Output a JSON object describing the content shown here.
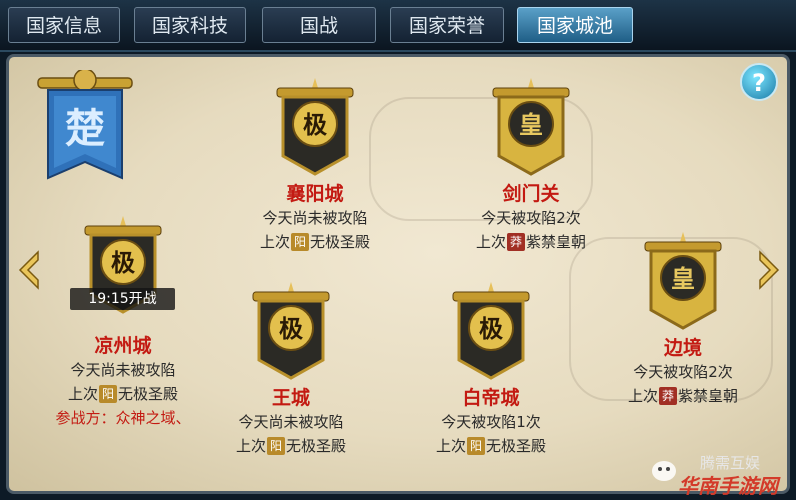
{
  "tabs": [
    {
      "label": "国家信息",
      "active": false
    },
    {
      "label": "国家科技",
      "active": false
    },
    {
      "label": "国战",
      "active": false
    },
    {
      "label": "国家荣誉",
      "active": false
    },
    {
      "label": "国家城池",
      "active": true
    }
  ],
  "help_label": "?",
  "faction": {
    "glyph": "楚"
  },
  "cities": [
    {
      "name": "襄阳城",
      "level_glyph": "极",
      "status": "今天尚未被攻陷",
      "last_prefix": "上次",
      "last_badge": "阳",
      "last_owner": "无极圣殿"
    },
    {
      "name": "剑门关",
      "level_glyph": "皇",
      "status": "今天被攻陷2次",
      "last_prefix": "上次",
      "last_badge": "莽",
      "last_owner": "紫禁皇朝"
    },
    {
      "name": "凉州城",
      "level_glyph": "极",
      "status": "今天尚未被攻陷",
      "last_prefix": "上次",
      "last_badge": "阳",
      "last_owner": "无极圣殿",
      "timer": "19:15开战",
      "participants": "参战方：众神之域、"
    },
    {
      "name": "王城",
      "level_glyph": "极",
      "status": "今天尚未被攻陷",
      "last_prefix": "上次",
      "last_badge": "阳",
      "last_owner": "无极圣殿"
    },
    {
      "name": "白帝城",
      "level_glyph": "极",
      "status": "今天被攻陷1次",
      "last_prefix": "上次",
      "last_badge": "阳",
      "last_owner": "无极圣殿"
    },
    {
      "name": "边境",
      "level_glyph": "皇",
      "status": "今天被攻陷2次",
      "last_prefix": "上次",
      "last_badge": "莽",
      "last_owner": "紫禁皇朝"
    }
  ],
  "watermark": {
    "line1": "腾需互娱",
    "line2": "华南手游网"
  },
  "colors": {
    "accent_tab": "#2f7fae",
    "city_name": "#c31a12",
    "gold": "#c9a233"
  }
}
